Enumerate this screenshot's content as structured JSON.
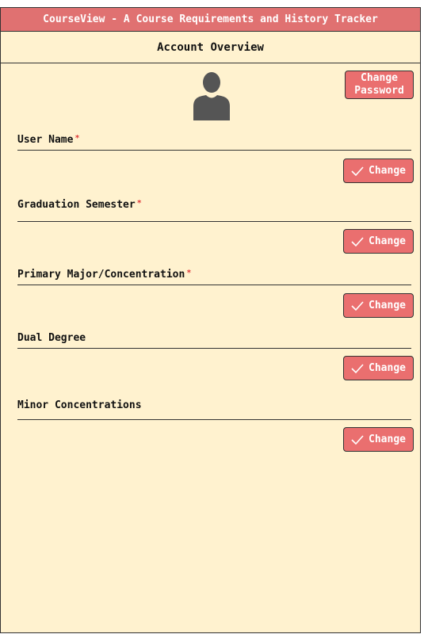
{
  "app": {
    "title": "CourseView - A Course Requirements and History Tracker"
  },
  "page": {
    "heading": "Account Overview"
  },
  "account": {
    "change_password_line1": "Change",
    "change_password_line2": "Password"
  },
  "required_marker": "*",
  "fields": [
    {
      "label": "User Name",
      "required": true,
      "value": "",
      "button_label": "Change"
    },
    {
      "label": "Graduation Semester",
      "required": true,
      "value": "",
      "button_label": "Change"
    },
    {
      "label": "Primary Major/Concentration",
      "required": true,
      "value": "",
      "button_label": "Change"
    },
    {
      "label": "Dual Degree",
      "required": false,
      "value": "",
      "button_label": "Change"
    },
    {
      "label": "Minor Concentrations",
      "required": false,
      "value": "",
      "button_label": "Change"
    }
  ],
  "icons": {
    "avatar": "user-silhouette-icon",
    "check": "checkmark-icon"
  },
  "colors": {
    "accent": "#ea6f6f",
    "titlebar": "#e07171",
    "background": "#fff2cf",
    "required": "#e03b3b"
  }
}
